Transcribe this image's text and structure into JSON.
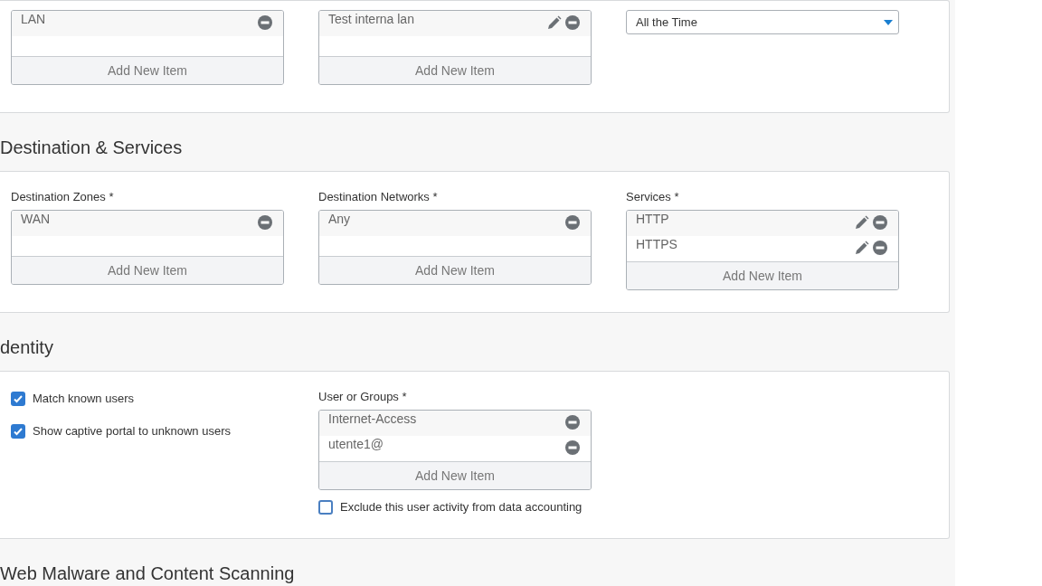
{
  "sections": [
    {
      "columns": [
        [
          {
            "kind": "list",
            "entries": [
              {
                "text": "LAN",
                "editable": false
              }
            ],
            "add_label": "Add New Item"
          }
        ],
        [
          {
            "kind": "list",
            "entries": [
              {
                "text": "Test interna lan",
                "editable": true
              }
            ],
            "add_label": "Add New Item"
          }
        ],
        [
          {
            "kind": "select",
            "value": "All the Time"
          }
        ]
      ]
    },
    {
      "title": "Destination & Services",
      "columns": [
        [
          {
            "kind": "list",
            "label": "Destination Zones *",
            "entries": [
              {
                "text": "WAN",
                "editable": false
              }
            ],
            "add_label": "Add New Item"
          }
        ],
        [
          {
            "kind": "list",
            "label": "Destination Networks *",
            "entries": [
              {
                "text": "Any",
                "editable": false
              }
            ],
            "add_label": "Add New Item"
          }
        ],
        [
          {
            "kind": "list",
            "label": "Services *",
            "entries": [
              {
                "text": "HTTP",
                "editable": true
              },
              {
                "text": "HTTPS",
                "editable": true
              }
            ],
            "add_label": "Add New Item"
          }
        ]
      ]
    },
    {
      "title": "dentity",
      "columns": [
        [
          {
            "kind": "checkbox",
            "label": "Match known users",
            "checked": true
          },
          {
            "kind": "checkbox",
            "label": "Show captive portal to unknown users",
            "checked": true
          }
        ],
        [
          {
            "kind": "list",
            "label": "User or Groups *",
            "entries": [
              {
                "text": "Internet-Access",
                "editable": false
              },
              {
                "text": "utente1@",
                "editable": false
              }
            ],
            "add_label": "Add New Item"
          },
          {
            "kind": "checkbox",
            "label": "Exclude this user activity from data accounting",
            "checked": false
          }
        ]
      ]
    },
    {
      "title": "Web Malware and Content Scanning"
    }
  ]
}
